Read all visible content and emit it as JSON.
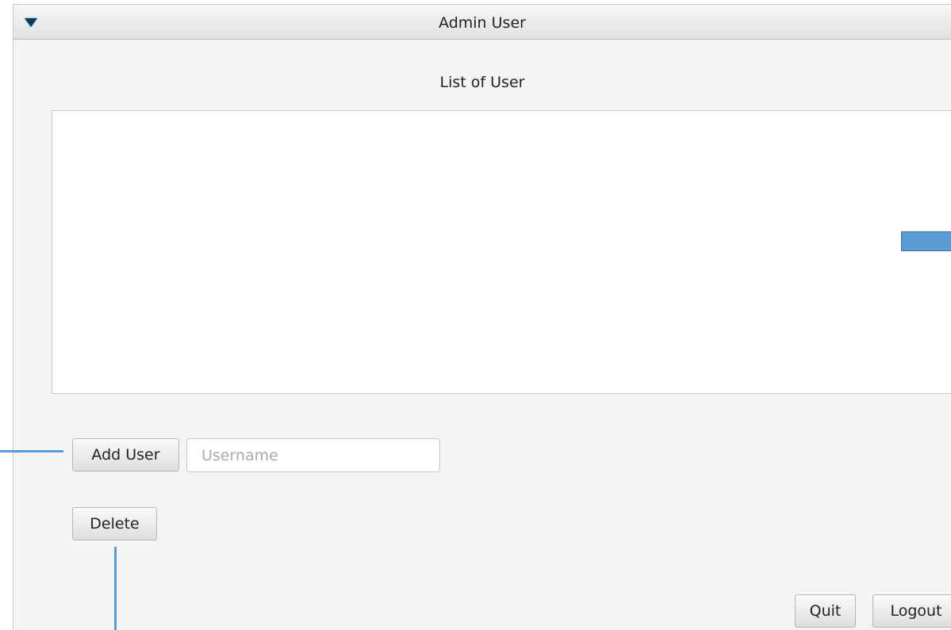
{
  "window": {
    "title": "Admin User"
  },
  "main": {
    "list_label": "List of User",
    "users": []
  },
  "controls": {
    "add_user_label": "Add User",
    "username_placeholder": "Username",
    "username_value": "",
    "delete_label": "Delete",
    "quit_label": "Quit",
    "logout_label": "Logout"
  },
  "colors": {
    "annotation": "#5b9bd5",
    "window_background": "#f4f4f4"
  },
  "icons": {
    "collapse": "triangle-down"
  }
}
